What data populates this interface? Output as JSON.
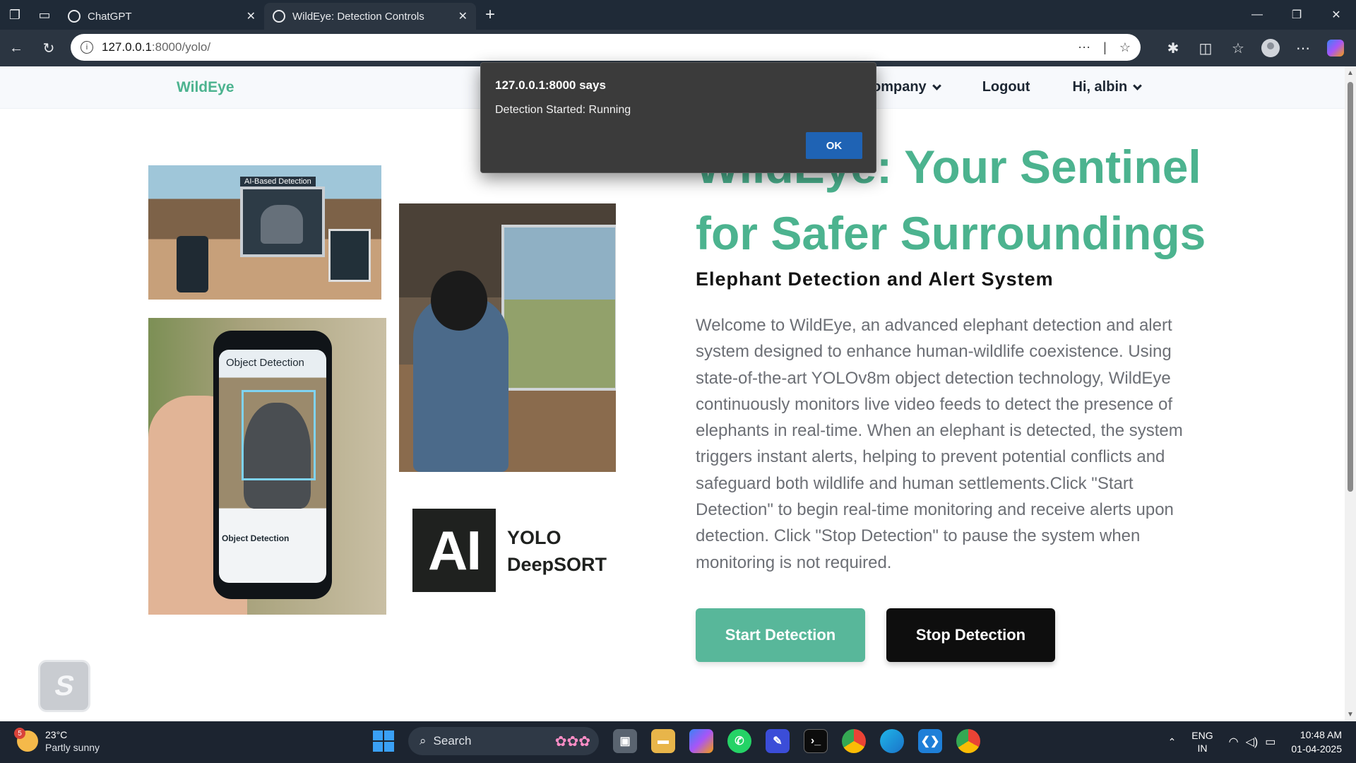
{
  "browser": {
    "tabs": [
      {
        "title": "ChatGPT",
        "active": false
      },
      {
        "title": "WildEye: Detection Controls",
        "active": true
      }
    ],
    "url_host": "127.0.0.1",
    "url_path": ":8000/yolo/"
  },
  "site": {
    "brand": "WildEye",
    "nav": [
      {
        "label": "ompany",
        "dropdown": true
      },
      {
        "label": "Logout",
        "dropdown": false
      },
      {
        "label": "Hi, albin",
        "dropdown": true
      }
    ]
  },
  "hero": {
    "title_line1": "WildEye: Your Sentinel",
    "title_line2": "for Safer Surroundings",
    "subtitle": "Elephant Detection and Alert System",
    "description": "Welcome to WildEye, an advanced elephant detection and alert system designed to enhance human-wildlife coexistence. Using state-of-the-art YOLOv8m object detection technology, WildEye continuously monitors live video feeds to detect the presence of elephants in real-time. When an elephant is detected, the system triggers instant alerts, helping to prevent potential conflicts and safeguard both wildlife and human settlements.Click \"Start Detection\" to begin real-time monitoring and receive alerts upon detection. Click \"Stop Detection\" to pause the system when monitoring is not required.",
    "start_label": "Start Detection",
    "stop_label": "Stop Detection"
  },
  "images": {
    "img1_caption": "AI-Based Detection",
    "img3_label": "Object Detection",
    "img3_label2": "Object Detection",
    "ai_logo": "AI",
    "ai_line1": "YOLO",
    "ai_line2": "DeepSORT"
  },
  "dialog": {
    "title": "127.0.0.1:8000 says",
    "message": "Detection Started: Running",
    "ok_label": "OK"
  },
  "taskbar": {
    "weather_badge": "5",
    "temperature": "23°C",
    "condition": "Partly sunny",
    "search_label": "Search",
    "lang_line1": "ENG",
    "lang_line2": "IN",
    "time": "10:48 AM",
    "date": "01-04-2025"
  },
  "colors": {
    "brand_green": "#4cb38f",
    "start_button": "#58b79a",
    "stop_button": "#0e0e0e",
    "dialog_ok": "#1f63b4"
  }
}
